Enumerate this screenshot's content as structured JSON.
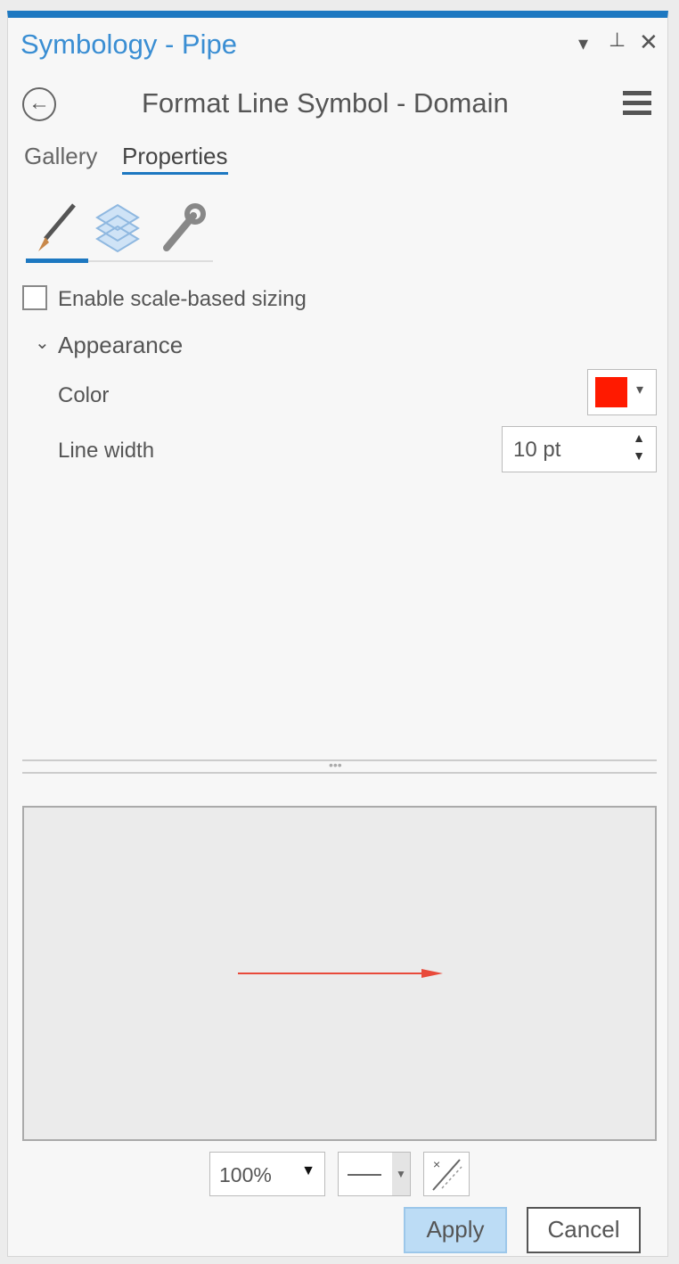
{
  "pane": {
    "title": "Symbology - Pipe",
    "accent": "#1d78c1"
  },
  "header": {
    "title": "Format Line Symbol - Domain"
  },
  "tabs": [
    {
      "label": "Gallery",
      "active": false
    },
    {
      "label": "Properties",
      "active": true
    }
  ],
  "subtabs": [
    {
      "icon": "paintbrush-icon",
      "active": true
    },
    {
      "icon": "layers-icon"
    },
    {
      "icon": "wrench-icon"
    }
  ],
  "scale_sizing": {
    "label": "Enable scale-based sizing",
    "checked": false
  },
  "appearance": {
    "heading": "Appearance",
    "color_label": "Color",
    "color_value": "#ff1a00",
    "width_label": "Line width",
    "width_value": "10 pt"
  },
  "preview": {
    "line_color": "#e84a3a"
  },
  "footer": {
    "zoom": "100%",
    "apply": "Apply",
    "cancel": "Cancel"
  }
}
